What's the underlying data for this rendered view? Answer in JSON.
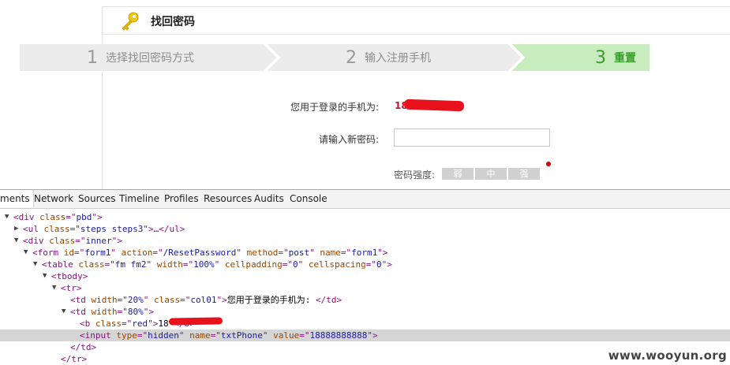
{
  "page": {
    "title": "找回密码",
    "steps": [
      {
        "num": "1",
        "label": "选择找回密码方式",
        "active": false
      },
      {
        "num": "2",
        "label": "输入注册手机",
        "active": false
      },
      {
        "num": "3",
        "label": "重置",
        "active": true
      }
    ],
    "phone_label": "您用于登录的手机为:",
    "phone_value_prefix": "18",
    "new_password_label": "请输入新密码:",
    "new_password_value": "",
    "strength_label": "密码强度:",
    "strength_levels": [
      "弱",
      "中",
      "强"
    ]
  },
  "devtools": {
    "tabs": [
      "ments",
      "Network",
      "Sources",
      "Timeline",
      "Profiles",
      "Resources",
      "Audits",
      "Console"
    ],
    "lines": [
      {
        "indent": 0,
        "tri": "▼",
        "parts": [
          [
            "tg",
            "<div "
          ],
          [
            "an",
            "class"
          ],
          [
            "tg",
            "=\""
          ],
          [
            "av",
            "pbd"
          ],
          [
            "tg",
            "\">"
          ]
        ]
      },
      {
        "indent": 1,
        "tri": "▶",
        "parts": [
          [
            "tg",
            "<ul "
          ],
          [
            "an",
            "class"
          ],
          [
            "tg",
            "=\""
          ],
          [
            "av",
            "steps steps3"
          ],
          [
            "tg",
            "\">…</ul>"
          ]
        ]
      },
      {
        "indent": 1,
        "tri": "▼",
        "parts": [
          [
            "tg",
            "<div "
          ],
          [
            "an",
            "class"
          ],
          [
            "tg",
            "=\""
          ],
          [
            "av",
            "inner"
          ],
          [
            "tg",
            "\">"
          ]
        ]
      },
      {
        "indent": 2,
        "tri": "▼",
        "parts": [
          [
            "tg",
            "<form "
          ],
          [
            "an",
            "id"
          ],
          [
            "tg",
            "=\""
          ],
          [
            "av",
            "form1"
          ],
          [
            "tg",
            "\" "
          ],
          [
            "an",
            "action"
          ],
          [
            "tg",
            "=\""
          ],
          [
            "av",
            "/ResetPassword"
          ],
          [
            "tg",
            "\" "
          ],
          [
            "an",
            "method"
          ],
          [
            "tg",
            "=\""
          ],
          [
            "av",
            "post"
          ],
          [
            "tg",
            "\" "
          ],
          [
            "an",
            "name"
          ],
          [
            "tg",
            "=\""
          ],
          [
            "av",
            "form1"
          ],
          [
            "tg",
            "\">"
          ]
        ]
      },
      {
        "indent": 3,
        "tri": "▼",
        "parts": [
          [
            "tg",
            "<table "
          ],
          [
            "an",
            "class"
          ],
          [
            "tg",
            "=\""
          ],
          [
            "av",
            "fm fm2"
          ],
          [
            "tg",
            "\" "
          ],
          [
            "an",
            "width"
          ],
          [
            "tg",
            "=\""
          ],
          [
            "av",
            "100%"
          ],
          [
            "tg",
            "\" "
          ],
          [
            "an",
            "cellpadding"
          ],
          [
            "tg",
            "=\""
          ],
          [
            "av",
            "0"
          ],
          [
            "tg",
            "\" "
          ],
          [
            "an",
            "cellspacing"
          ],
          [
            "tg",
            "=\""
          ],
          [
            "av",
            "0"
          ],
          [
            "tg",
            "\">"
          ]
        ]
      },
      {
        "indent": 4,
        "tri": "▼",
        "parts": [
          [
            "tg",
            "<tbody>"
          ]
        ]
      },
      {
        "indent": 5,
        "tri": "▼",
        "parts": [
          [
            "tg",
            "<tr>"
          ]
        ]
      },
      {
        "indent": 6,
        "tri": "",
        "parts": [
          [
            "tg",
            "<td "
          ],
          [
            "an",
            "width"
          ],
          [
            "tg",
            "=\""
          ],
          [
            "av",
            "20%"
          ],
          [
            "tg",
            "\" "
          ],
          [
            "an",
            "class"
          ],
          [
            "tg",
            "=\""
          ],
          [
            "av",
            "col01"
          ],
          [
            "tg",
            "\">"
          ],
          [
            "tx",
            "您用于登录的手机为: "
          ],
          [
            "tg",
            "</td>"
          ]
        ]
      },
      {
        "indent": 6,
        "tri": "▼",
        "parts": [
          [
            "tg",
            "<td "
          ],
          [
            "an",
            "width"
          ],
          [
            "tg",
            "=\""
          ],
          [
            "av",
            "80%"
          ],
          [
            "tg",
            "\">"
          ]
        ]
      },
      {
        "indent": 7,
        "tri": "",
        "parts": [
          [
            "tg",
            "<b "
          ],
          [
            "an",
            "class"
          ],
          [
            "tg",
            "=\""
          ],
          [
            "av",
            "red"
          ],
          [
            "tg",
            "\">"
          ],
          [
            "tx",
            "18"
          ],
          [
            "tx",
            "           "
          ],
          [
            "tg",
            "</b>"
          ]
        ]
      },
      {
        "indent": 7,
        "tri": "",
        "hl": true,
        "parts": [
          [
            "tg",
            "<input "
          ],
          [
            "an",
            "type"
          ],
          [
            "tg",
            "=\""
          ],
          [
            "av",
            "hidden"
          ],
          [
            "tg",
            "\" "
          ],
          [
            "an",
            "name"
          ],
          [
            "tg",
            "=\""
          ],
          [
            "av",
            "txtPhone"
          ],
          [
            "tg",
            "\" "
          ],
          [
            "an",
            "value"
          ],
          [
            "tg",
            "=\""
          ],
          [
            "av",
            "18888888888"
          ],
          [
            "tg",
            "\">"
          ]
        ]
      },
      {
        "indent": 6,
        "tri": "",
        "parts": [
          [
            "tg",
            "</td>"
          ]
        ]
      },
      {
        "indent": 5,
        "tri": "",
        "parts": [
          [
            "tg",
            "</tr>"
          ]
        ]
      }
    ]
  },
  "watermark": "www.wooyun.org",
  "colors": {
    "accent_green": "#3c9a2e",
    "redact_red": "#e8111c",
    "highlight_row": "#d5d5d5"
  }
}
